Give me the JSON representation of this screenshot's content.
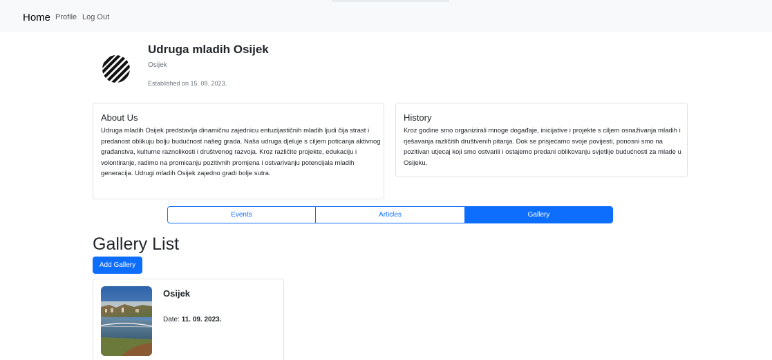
{
  "navbar": {
    "brand": "Home",
    "links": [
      {
        "label": "Profile"
      },
      {
        "label": "Log Out"
      }
    ]
  },
  "organization": {
    "name": "Udruga mladih Osijek",
    "city": "Osijek",
    "established": "Established on 15. 09. 2023."
  },
  "about": {
    "title": "About Us",
    "text": "Udruga mladih Osijek predstavlja dinamičnu zajednicu entuzijastičnih mladih ljudi čija strast i predanost oblikuju bolju budućnost našeg grada. Naša udruga djeluje s ciljem poticanja aktivnog građanstva, kulturne raznolikosti i društvenog razvoja. Kroz različite projekte, edukaciju i volontiranje, radimo na promicanju pozitivnih promjena i ostvarivanju potencijala mladih generacija. Udrugi mladih Osijek zajedno gradi bolje sutra."
  },
  "history": {
    "title": "History",
    "text": "Kroz godine smo organizirali mnoge događaje, inicijative i projekte s ciljem osnaživanja mladih i rješavanja različitih društvenih pitanja. Dok se prisjećamo svoje povijesti, ponosni smo na pozitivan utjecaj koji smo ostvarili i ostajemo predani oblikovanju svjetlije budućnosti za mlade u Osijeku."
  },
  "tabs": [
    {
      "label": "Events"
    },
    {
      "label": "Articles"
    },
    {
      "label": "Gallery"
    }
  ],
  "active_tab": "Gallery",
  "gallery_section": {
    "title": "Gallery List",
    "add_button": "Add Gallery",
    "items": [
      {
        "name": "Osijek",
        "date_label": "Date:",
        "date_value": "11. 09. 2023."
      }
    ]
  },
  "colors": {
    "primary": "#0d6efd",
    "navbar_bg": "#f8f9fa",
    "border": "#dee2e6"
  },
  "icons": {
    "logo": "striped-circle-logo"
  }
}
